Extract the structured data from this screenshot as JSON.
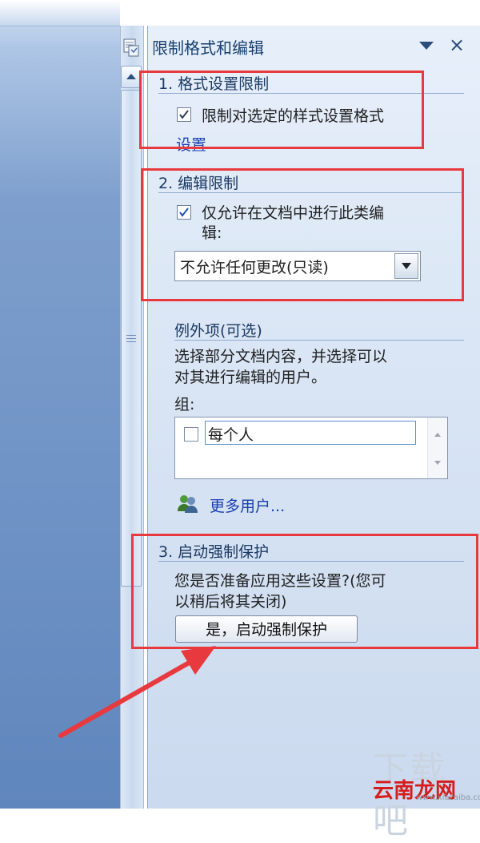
{
  "pane": {
    "title": "限制格式和编辑",
    "close_glyph": "×"
  },
  "section1": {
    "heading": "1. 格式设置限制",
    "checkbox_label": "限制对选定的样式设置格式",
    "checked": true,
    "link": "设置"
  },
  "section2": {
    "heading": "2. 编辑限制",
    "checkbox_label_line1": "仅允许在文档中进行此类编",
    "checkbox_label_line2": "辑:",
    "checked": true,
    "select_value": "不允许任何更改(只读)"
  },
  "exceptions": {
    "heading": "例外项(可选)",
    "desc_line1": "选择部分文档内容，并选择可以",
    "desc_line2": "对其进行编辑的用户。",
    "group_label": "组:",
    "list_items": [
      {
        "label": "每个人",
        "checked": false
      }
    ],
    "more_users": "更多用户..."
  },
  "section3": {
    "heading": "3. 启动强制保护",
    "desc_line1": "您是否准备应用这些设置?(您可",
    "desc_line2": "以稍后将其关闭)",
    "button": "是，启动强制保护"
  },
  "watermark": {
    "line1": "下载吧",
    "line2": "云南龙网",
    "line3": "www.xiazaiba.com"
  },
  "colors": {
    "highlight_red": "#e83a3e",
    "pane_bg": "#dae6f5",
    "link_blue": "#1a3fb0"
  },
  "icons": [
    "pane-icon",
    "dropdown-arrow-icon",
    "close-icon",
    "checkmark-icon",
    "users-icon",
    "scroll-up-icon",
    "scroll-down-icon",
    "grip-icon",
    "red-arrow"
  ]
}
